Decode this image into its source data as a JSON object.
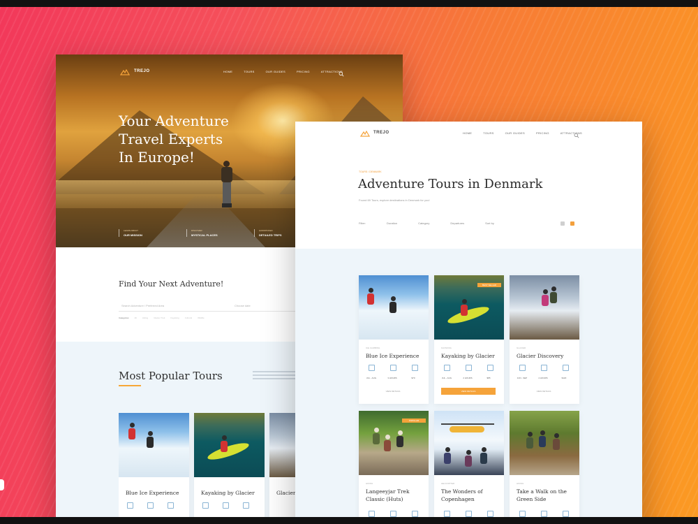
{
  "colors": {
    "accent": "#f5a33a",
    "bg_left": "#f2385a",
    "bg_right": "#fb9a22",
    "section_bg": "#eef5fa"
  },
  "back_page": {
    "brand": "TREJO",
    "nav": [
      "HOME",
      "TOURS",
      "OUR GUIDES",
      "PRICING",
      "ATTRACTIONS"
    ],
    "hero": {
      "title_lines": [
        "Your Adventure",
        "Travel Experts",
        "In Europe!"
      ],
      "stats": [
        {
          "label": "LEARN ABOUT",
          "value": "OUR MISSION"
        },
        {
          "label": "DISCOVER",
          "value": "MYSTICAL PLACES"
        },
        {
          "label": "HANDPICKED",
          "value": "DETAILED TRIPS"
        }
      ]
    },
    "find": {
      "title": "Find Your Next Adventure!",
      "search_placeholder": "Search Adventure / Preferred Area",
      "date_placeholder": "Choose date",
      "tags": [
        "Categories",
        "All",
        "Hiking",
        "Glacier Trek",
        "Kayaking",
        "Cultural",
        "Wildlife"
      ]
    },
    "popular": {
      "title": "Most Popular Tours",
      "tours": [
        {
          "name": "Blue Ice Experience",
          "photo": "ice"
        },
        {
          "name": "Kayaking by Glacier",
          "photo": "kayak"
        },
        {
          "name": "Glacier Discovery",
          "photo": "glacier"
        }
      ]
    }
  },
  "front_page": {
    "brand": "TREJO",
    "nav": [
      "HOME",
      "TOURS",
      "OUR GUIDES",
      "PRICING",
      "ATTRACTIONS"
    ],
    "breadcrumb": "TOURS / DENMARK",
    "title": "Adventure Tours in Denmark",
    "subtitle": "Found 69 Tours, explore destinations in Denmark for you!",
    "filters": [
      "Filter:",
      "Duration",
      "Category",
      "Departures",
      "Sort by"
    ],
    "tours": [
      {
        "category": "ICE CLIMBING",
        "name": "Blue Ice Experience",
        "photo": "ice",
        "vals": [
          "JUL - AUG",
          "3 HOURS",
          "$70"
        ],
        "button": "VIEW DETAILS",
        "primary": false,
        "badge": ""
      },
      {
        "category": "KAYAKING",
        "name": "Kayaking by Glacier",
        "photo": "kayak",
        "vals": [
          "JUL - AUG",
          "2 HOURS",
          "$85"
        ],
        "button": "VIEW DETAILS",
        "primary": true,
        "badge": "BEST SELLER"
      },
      {
        "category": "GLACIER",
        "name": "Glacier Discovery",
        "photo": "glacier",
        "vals": [
          "JUN - SEP",
          "4 HOURS",
          "$120"
        ],
        "button": "VIEW DETAILS",
        "primary": false,
        "badge": ""
      },
      {
        "category": "HIKING",
        "name": "Langeeyjar Trek Classic (Huts)",
        "photo": "trek",
        "vals": [
          "",
          "",
          ""
        ],
        "button": "",
        "primary": false,
        "badge": "POPULAR"
      },
      {
        "category": "HELICOPTER",
        "name": "The Wonders of Copenhagen",
        "photo": "heli",
        "vals": [
          "",
          "",
          ""
        ],
        "button": "",
        "primary": false,
        "badge": ""
      },
      {
        "category": "HIKING",
        "name": "Take a Walk on the Green Side",
        "photo": "forest",
        "vals": [
          "",
          "",
          ""
        ],
        "button": "",
        "primary": false,
        "badge": ""
      }
    ]
  }
}
